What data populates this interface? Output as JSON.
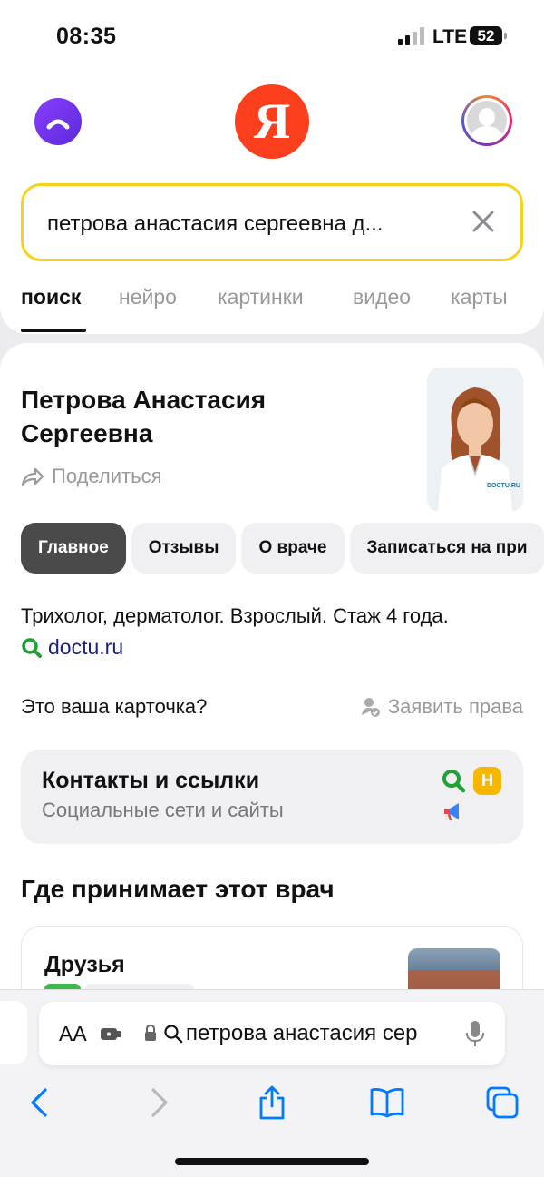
{
  "status": {
    "time": "08:35",
    "network": "LTE",
    "battery": "52"
  },
  "header": {
    "logo": "Я",
    "search": {
      "query": "петрова анастасия сергеевна д..."
    },
    "tabs": [
      {
        "label": "поиск",
        "active": true
      },
      {
        "label": "нейро"
      },
      {
        "label": "картинки"
      },
      {
        "label": "видео"
      },
      {
        "label": "карты"
      }
    ]
  },
  "card": {
    "name_line1": "Петрова Анастасия",
    "name_line2": "Сергеевна",
    "share_label": "Поделиться",
    "photo_brand": "DOCTU.RU",
    "chips": [
      {
        "label": "Главное",
        "active": true
      },
      {
        "label": "Отзывы"
      },
      {
        "label": "О враче"
      },
      {
        "label": "Записаться на при"
      }
    ],
    "description": "Трихолог, дерматолог. Взрослый. Стаж 4 года.",
    "source": "doctu.ru",
    "ownership_question": "Это ваша карточка?",
    "claim_label": "Заявить права",
    "contacts": {
      "title": "Контакты и ссылки",
      "subtitle": "Социальные сети и сайты",
      "badge_letter": "Н"
    },
    "where_title": "Где принимает этот врач",
    "place": {
      "name": "Друзья"
    }
  },
  "browser": {
    "aa_label": "AA",
    "url": "петрова анастасия сер"
  },
  "icons": {
    "accent": "#f8d21a",
    "yandex_red": "#fc3f1d",
    "alice_purple": "#7a36f0",
    "link_blue": "#007aff"
  }
}
